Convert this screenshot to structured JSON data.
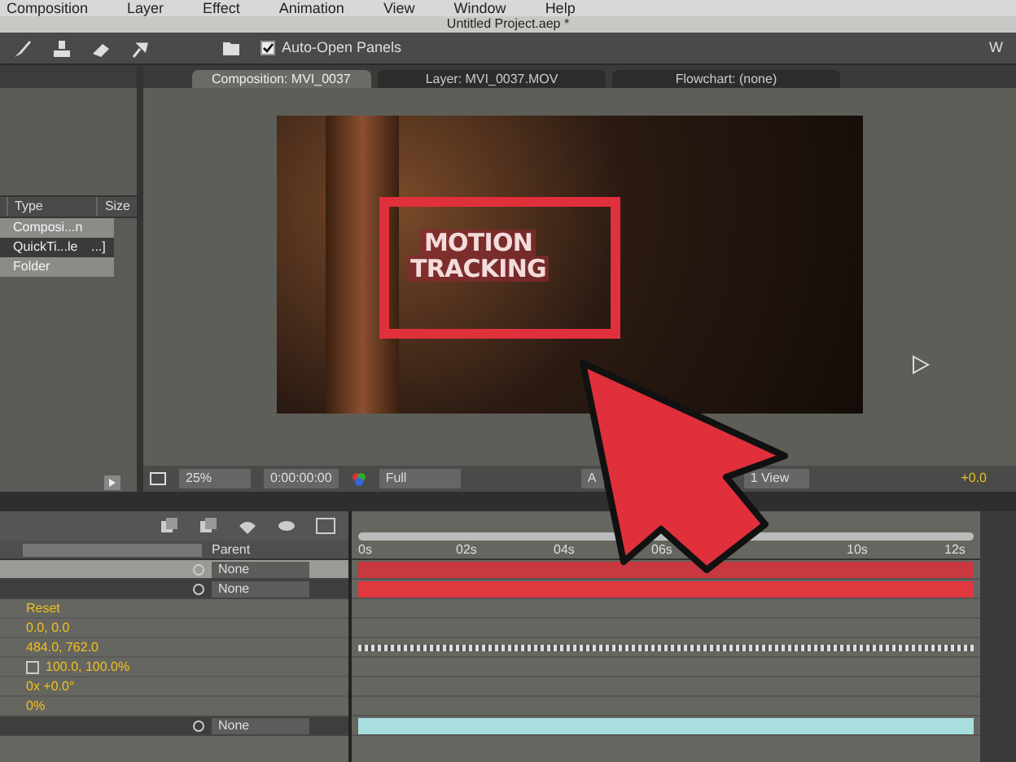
{
  "menu_bar": {
    "items": [
      "Composition",
      "Layer",
      "Effect",
      "Animation",
      "View",
      "Window",
      "Help"
    ]
  },
  "window": {
    "title": "Untitled Project.aep *"
  },
  "toolbar": {
    "auto_open_panels": {
      "label": "Auto-Open Panels",
      "checked": true
    },
    "workspace": "W"
  },
  "project_panel": {
    "columns": [
      "Type",
      "Size"
    ],
    "rows": [
      {
        "type": "Composi...n",
        "size": "",
        "selected": false
      },
      {
        "type": "QuickTi...le",
        "size": "...]",
        "selected": true
      },
      {
        "type": "Folder",
        "size": "",
        "selected": false
      }
    ]
  },
  "viewer_tabs": [
    {
      "label": "Composition: MVI_0037",
      "selected": true
    },
    {
      "label": "Layer: MVI_0037.MOV",
      "selected": false
    },
    {
      "label": "Flowchart: (none)",
      "selected": false
    }
  ],
  "viewer": {
    "comp_title": [
      "MOTION",
      "TRACKING"
    ]
  },
  "viewer_footer": {
    "zoom": "25%",
    "timecode": "0:00:00:00",
    "resolution": "Full",
    "camera": "A",
    "views": "1 View",
    "exposure": "+0.0"
  },
  "timeline": {
    "ruler": [
      "0s",
      "02s",
      "04s",
      "06s",
      "10s",
      "12s"
    ],
    "parent_header": "Parent",
    "rows": [
      {
        "kind": "layer",
        "parent": "None",
        "selected": true,
        "color": "#c8383e"
      },
      {
        "kind": "layer",
        "parent": "None",
        "selected": false,
        "color": "#e0383e"
      },
      {
        "kind": "property",
        "value": "Reset"
      },
      {
        "kind": "property",
        "value": "0.0, 0.0"
      },
      {
        "kind": "tracked",
        "value": "484.0, 762.0"
      },
      {
        "kind": "scale",
        "value": "100.0, 100.0%"
      },
      {
        "kind": "property",
        "value": "0x +0.0°"
      },
      {
        "kind": "property",
        "value": "0%"
      },
      {
        "kind": "layer",
        "parent": "None",
        "selected": false,
        "color": "#a8dede"
      }
    ]
  }
}
